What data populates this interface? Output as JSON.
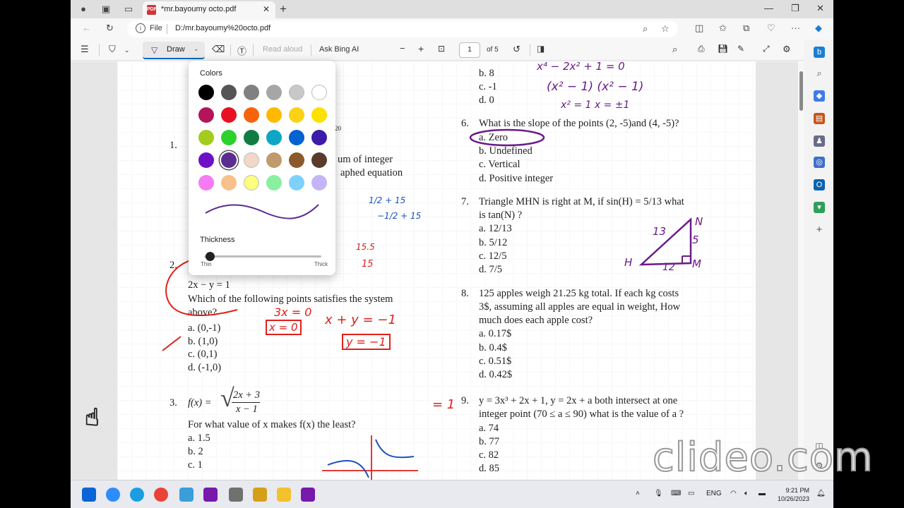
{
  "browser": {
    "tab_title": "*mr.bayoumy octo.pdf",
    "url_prefix": "File",
    "url": "D:/mr.bayoumy%20octo.pdf"
  },
  "pdf_toolbar": {
    "draw_label": "Draw",
    "read_aloud_label": "Read aloud",
    "ask_bing_label": "Ask Bing AI",
    "page_number": "1",
    "page_total": "of 5"
  },
  "popup": {
    "colors_title": "Colors",
    "swatches": [
      "#000000",
      "#555555",
      "#808080",
      "#a6a6a6",
      "#c8c8c8",
      "#ffffff",
      "#b4145a",
      "#e81123",
      "#f7630c",
      "#ffb900",
      "#fcd116",
      "#fce100",
      "#a4cc1c",
      "#2dd12d",
      "#107c41",
      "#0ea5c6",
      "#0063d1",
      "#3b1ba8",
      "#6e10c8",
      "#5c2d91",
      "#f3d7c9",
      "#c19a6b",
      "#8b5a2b",
      "#5a3a2a",
      "#f67af4",
      "#f8c08a",
      "#fdfd80",
      "#89f0a2",
      "#7ed1fb",
      "#c4b4f8"
    ],
    "selected_color": "#5c2d91",
    "thickness_title": "Thickness",
    "thin_label": "Thin",
    "thick_label": "Thick"
  },
  "page": {
    "q1": {
      "num": "1."
    },
    "q2": {
      "num": "2.",
      "eq": "2x − y = 1",
      "text1": "Which of the following points satisfies the system",
      "text2": "above?",
      "a": "a.   (0,-1)",
      "b": "b.   (1,0)",
      "c": "c.   (0,1)",
      "d": "d.   (-1,0)"
    },
    "q3": {
      "num": "3.",
      "fx": "f(x) =",
      "num_expr": "2x + 3",
      "den_expr": "x − 1",
      "text": "For what value of x makes f(x) the least?",
      "a": "a.   1.5",
      "b": "b.   2",
      "c": "c.   1"
    },
    "q5_tail": {
      "b": "b.   8",
      "c": "c.   -1",
      "d": "d.   0"
    },
    "q6": {
      "num": "6.",
      "text": "What is the slope of the points (2, -5)and (4, -5)?",
      "a": "a.   Zero",
      "b": "b.   Undefined",
      "c": "c.   Vertical",
      "d": "d.   Positive integer"
    },
    "q7": {
      "num": "7.",
      "text1": "Triangle MHN  is right at M, if sin(H) = 5/13 what",
      "text2": "is tan(N) ?",
      "a": "a.   12/13",
      "b": "b.   5/12",
      "c": "c.   12/5",
      "d": "d.   7/5"
    },
    "q8": {
      "num": "8.",
      "text1": "125 apples weigh 21.25 kg total. If each kg costs",
      "text2": "3$, assuming all apples are equal in weight, How",
      "text3": "much does each apple cost?",
      "a": "a.   0.17$",
      "b": "b.   0.4$",
      "c": "c.   0.51$",
      "d": "d.   0.42$"
    },
    "q9": {
      "num": "9.",
      "text1": "y = 3x³ + 2x + 1, y = 2x + a both intersect at one",
      "text2": "integer point (70 ≤ a ≤ 90) what is the value of a ?",
      "a": "a.   74",
      "b": "b.   77",
      "c": "c.   82",
      "d": "d.   85"
    },
    "fragments": {
      "f1": "um of integer",
      "f2": "aphed equation",
      "axis20": "20"
    }
  },
  "handwriting": {
    "q5_work1": "x⁴ − 2x² + 1 = 0",
    "q5_work2": "(x² − 1)   (x² − 1)",
    "q5_work3": "x² = 1    x = ±1",
    "q2_work1": "3x = 0",
    "q2_work2": "x = 0",
    "q2_work3": "x + y = −1",
    "q2_work4": "y = −1",
    "frac1": "1/2 + 15",
    "frac2": "−1/2 + 15",
    "n155": "15.5",
    "n15": "15",
    "tri_13": "13",
    "tri_5": "5",
    "tri_12": "12",
    "tri_H": "H",
    "tri_N": "N",
    "tri_M": "M",
    "q3_ans": "= 1"
  },
  "watermark": "clideo.com",
  "taskbar": {
    "lang": "ENG",
    "time": "9:21 PM",
    "date": "10/26/2023"
  }
}
